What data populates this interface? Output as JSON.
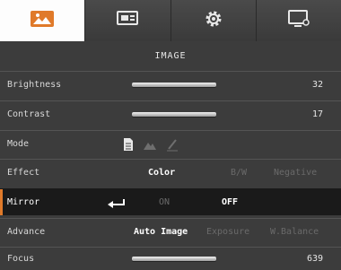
{
  "tabs": [
    {
      "icon": "image-icon",
      "active": true
    },
    {
      "icon": "presentation-icon",
      "active": false
    },
    {
      "icon": "gear-icon",
      "active": false
    },
    {
      "icon": "monitor-settings-icon",
      "active": false
    }
  ],
  "header": {
    "title": "IMAGE"
  },
  "rows": {
    "brightness": {
      "label": "Brightness",
      "value": "32"
    },
    "contrast": {
      "label": "Contrast",
      "value": "17"
    },
    "mode": {
      "label": "Mode",
      "icons": [
        "document-icon",
        "mountain-icon",
        "pen-icon"
      ]
    },
    "effect": {
      "label": "Effect",
      "options": [
        "Color",
        "B/W",
        "Negative"
      ],
      "selected": "Color"
    },
    "mirror": {
      "label": "Mirror",
      "options": [
        "ON",
        "OFF"
      ],
      "selected": "OFF",
      "icon": "enter-arrow-icon"
    },
    "advance": {
      "label": "Advance",
      "options": [
        "Auto Image",
        "Exposure",
        "W.Balance"
      ],
      "selected": "Auto Image"
    },
    "focus": {
      "label": "Focus",
      "value": "639"
    }
  },
  "colors": {
    "accent": "#e07a2a",
    "background": "#3c3c3c",
    "selected_row": "#1a1a1a"
  }
}
